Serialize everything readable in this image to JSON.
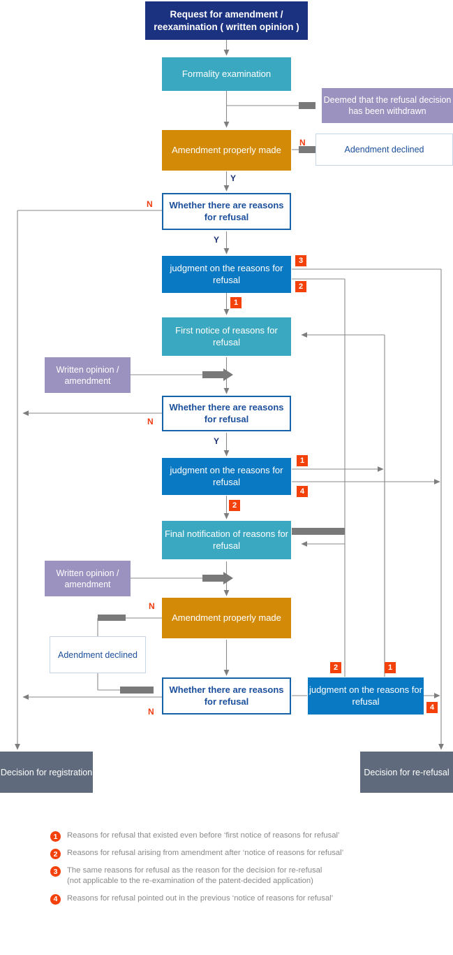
{
  "diagram": {
    "title": "Patent re-examination / amendment flowchart",
    "colors": {
      "navy": "#1b3281",
      "teal": "#3aa8c1",
      "orange": "#d38a06",
      "blue": "#0a79c4",
      "purple": "#9b92bf",
      "slate": "#5f6b7d",
      "badge": "#f4410a",
      "yes_label": "#17306e",
      "no_label": "#f03c11",
      "connector": "#808080"
    },
    "nodes": {
      "request": "Request for amendment / reexamination ( written opinion )",
      "formality": "Formality examination",
      "deemed_withdrawn": "Deemed that the refusal decision has been withdrawn",
      "amendment_properly_made_1": "Amendment properly made",
      "amendment_declined_1": "Adendment declined",
      "whether_reasons_1": "Whether there are reasons for refusal",
      "judgment_1": "judgment on the reasons for refusal",
      "first_notice": "First notice of reasons for refusal",
      "written_opinion_1": "Written opinion  / amendment",
      "whether_reasons_2": "Whether there are reasons for refusal",
      "judgment_2": "judgment on the reasons for refusal",
      "final_notification": "Final notification of reasons for refusal",
      "written_opinion_2": "Written opinion  / amendment",
      "amendment_properly_made_2": "Amendment properly made",
      "amendment_declined_2": "Adendment declined",
      "whether_reasons_3": "Whether there are reasons for refusal",
      "judgment_3": "judgment on the reasons for refusal",
      "decision_registration": "Decision for registration",
      "decision_re_refusal": "Decision for re-refusal"
    },
    "branch_labels": {
      "yes": "Y",
      "no": "N"
    },
    "edge_badges": [
      "1",
      "2",
      "3",
      "4"
    ],
    "legend": [
      {
        "num": "1",
        "line1": "Reasons for refusal  that existed even before ‘first notice of reasons for refusal’",
        "line2": ""
      },
      {
        "num": "2",
        "line1": "Reasons for refusal arising from amendment after ‘notice of reasons for refusal’",
        "line2": ""
      },
      {
        "num": "3",
        "line1": "The same reasons for refusal as the reason for the decision for re-refusal",
        "line2": "(not applicable to the re-examination of the patent-decided application)"
      },
      {
        "num": "4",
        "line1": "Reasons for refusal pointed out in the previous ‘notice of reasons for refusal’",
        "line2": ""
      }
    ]
  }
}
